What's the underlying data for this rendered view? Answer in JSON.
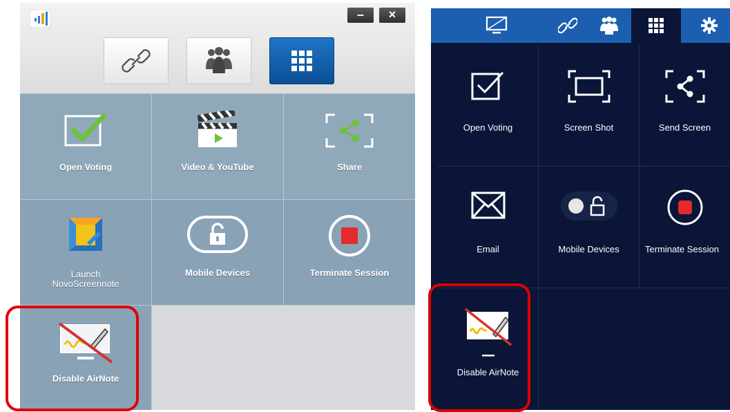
{
  "desktop": {
    "window_controls": {
      "minimize": "–",
      "close": "×"
    },
    "tiles": [
      {
        "label": "Open Voting"
      },
      {
        "label": "Video & YouTube"
      },
      {
        "label": "Share"
      },
      {
        "label": "Launch",
        "label2": "NovoScreennote"
      },
      {
        "label": "Mobile Devices"
      },
      {
        "label": "Terminate Session"
      },
      {
        "label": "Disable AirNote"
      }
    ]
  },
  "android": {
    "tiles": [
      {
        "label": "Open Voting"
      },
      {
        "label": "Screen Shot"
      },
      {
        "label": "Send Screen"
      },
      {
        "label": "Email"
      },
      {
        "label": "Mobile Devices"
      },
      {
        "label": "Terminate Session"
      },
      {
        "label": "Disable AirNote"
      }
    ]
  },
  "colors": {
    "highlight": "#e00000",
    "desktop_tab_active": "#1560b0",
    "android_tabbar": "#1c5fb0",
    "android_bg": "#0a1538",
    "check_green": "#6cc23a",
    "stop_red": "#e32b2b"
  }
}
